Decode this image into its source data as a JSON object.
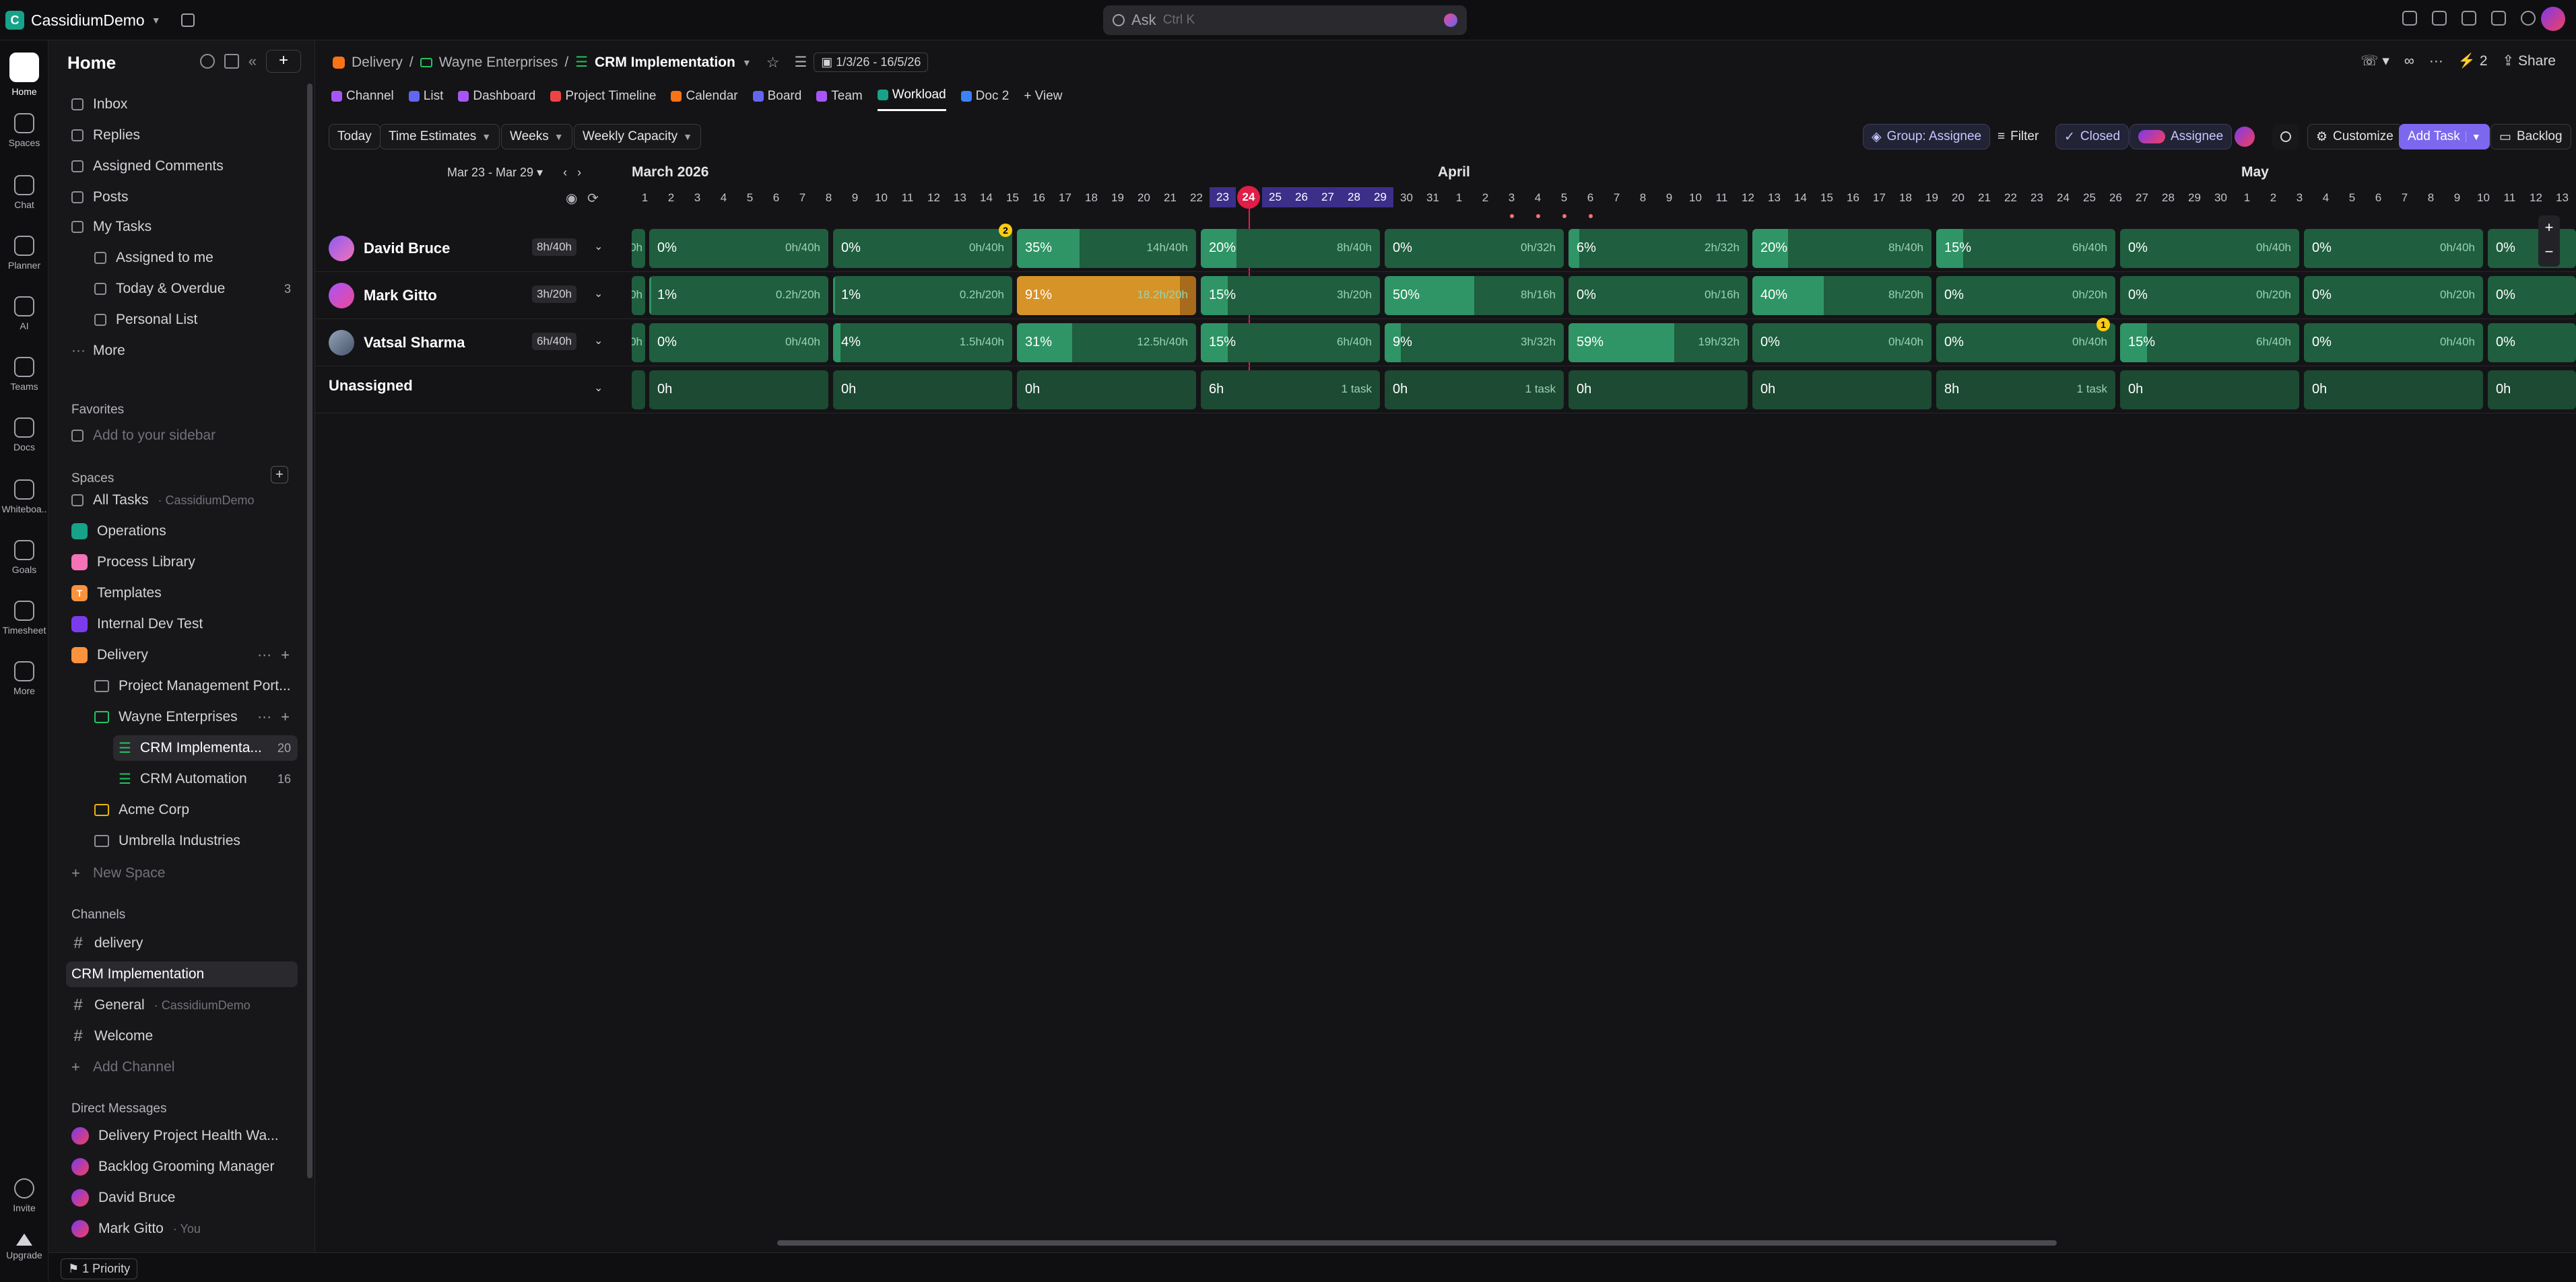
{
  "workspace": {
    "initial": "C",
    "name": "CassidiumDemo"
  },
  "search": {
    "placeholder": "Ask",
    "shortcut": "Ctrl K"
  },
  "rail": [
    {
      "label": "Home",
      "icon": "home-icon"
    },
    {
      "label": "Spaces",
      "icon": "spaces-icon"
    },
    {
      "label": "Chat",
      "icon": "chat-icon"
    },
    {
      "label": "Planner",
      "icon": "planner-icon"
    },
    {
      "label": "AI",
      "icon": "ai-icon"
    },
    {
      "label": "Teams",
      "icon": "teams-icon"
    },
    {
      "label": "Docs",
      "icon": "docs-icon"
    },
    {
      "label": "Whiteboa..",
      "icon": "whiteboard-icon"
    },
    {
      "label": "Goals",
      "icon": "goals-icon"
    },
    {
      "label": "Timesheet",
      "icon": "timesheet-icon"
    },
    {
      "label": "More",
      "icon": "more-icon"
    }
  ],
  "rail_bottom": {
    "invite": "Invite",
    "upgrade": "Upgrade"
  },
  "sidebar": {
    "title": "Home",
    "items": [
      "Inbox",
      "Replies",
      "Assigned Comments",
      "Posts",
      "My Tasks",
      "Assigned to me",
      "Today & Overdue",
      "Personal List",
      "More"
    ],
    "today_count": "3",
    "favorites_title": "Favorites",
    "favorites_add": "Add to your sidebar",
    "spaces_title": "Spaces",
    "all_tasks": "All Tasks",
    "all_tasks_sub": "· CassidiumDemo",
    "spaces": [
      "Operations",
      "Process Library",
      "Templates",
      "Internal Dev Test",
      "Delivery"
    ],
    "delivery_children": [
      "Project Management Port...",
      "Wayne Enterprises",
      "CRM Implementa...",
      "CRM Automation",
      "Acme Corp",
      "Umbrella Industries"
    ],
    "crm_impl_count": "20",
    "crm_auto_count": "16",
    "new_space": "New Space",
    "channels_title": "Channels",
    "channels": [
      "delivery",
      "CRM Implementation",
      "General",
      "Welcome"
    ],
    "general_sub": "· CassidiumDemo",
    "add_channel": "Add Channel",
    "dm_title": "Direct Messages",
    "dms": [
      "Delivery Project Health Wa...",
      "Backlog Grooming Manager",
      "David Bruce",
      "Mark Gitto"
    ],
    "dm_you": "· You"
  },
  "bottom": {
    "priority": "1 Priority"
  },
  "breadcrumb": [
    "Delivery",
    "Wayne Enterprises",
    "CRM Implementation"
  ],
  "date_chip": "1/3/26 - 16/5/26",
  "top_right": {
    "share": "Share",
    "count": "2"
  },
  "tabs": [
    "Channel",
    "List",
    "Dashboard",
    "Project Timeline",
    "Calendar",
    "Board",
    "Team",
    "Workload",
    "Doc 2",
    "+ View"
  ],
  "toolbar": {
    "today": "Today",
    "time_estimates": "Time Estimates",
    "weeks": "Weeks",
    "capacity": "Weekly Capacity",
    "group": "Group: Assignee",
    "filter": "Filter",
    "closed": "Closed",
    "assignee": "Assignee",
    "customize": "Customize",
    "add_task": "Add Task",
    "backlog": "Backlog"
  },
  "timeline": {
    "range": "Mar 23 - Mar 29",
    "months": [
      "March 2026",
      "April",
      "May"
    ],
    "days": [
      "1",
      "2",
      "3",
      "4",
      "5",
      "6",
      "7",
      "8",
      "9",
      "10",
      "11",
      "12",
      "13",
      "14",
      "15",
      "16",
      "17",
      "18",
      "19",
      "20",
      "21",
      "22",
      "23",
      "24",
      "25",
      "26",
      "27",
      "28",
      "29",
      "30",
      "31",
      "1",
      "2",
      "3",
      "4",
      "5",
      "6",
      "7",
      "8",
      "9",
      "10",
      "11",
      "12",
      "13",
      "14",
      "15",
      "16",
      "17",
      "18",
      "19",
      "20",
      "21",
      "22",
      "23",
      "24",
      "25",
      "26",
      "27",
      "28",
      "29",
      "30",
      "1",
      "2",
      "3",
      "4",
      "5",
      "6",
      "7",
      "8",
      "9",
      "10",
      "11",
      "12",
      "13"
    ],
    "today": "24",
    "badges": [
      "2",
      "1"
    ],
    "people": [
      {
        "name": "David Bruce",
        "cap": "8h/40h",
        "lead": "0h",
        "weeks": [
          {
            "pct": "0%",
            "hrs": "0h/40h",
            "fill": 0
          },
          {
            "pct": "0%",
            "hrs": "0h/40h",
            "fill": 0
          },
          {
            "pct": "35%",
            "hrs": "14h/40h",
            "fill": 0.35
          },
          {
            "pct": "20%",
            "hrs": "8h/40h",
            "fill": 0.2
          },
          {
            "pct": "0%",
            "hrs": "0h/32h",
            "fill": 0
          },
          {
            "pct": "6%",
            "hrs": "2h/32h",
            "fill": 0.06
          },
          {
            "pct": "20%",
            "hrs": "8h/40h",
            "fill": 0.2
          },
          {
            "pct": "15%",
            "hrs": "6h/40h",
            "fill": 0.15
          },
          {
            "pct": "0%",
            "hrs": "0h/40h",
            "fill": 0
          },
          {
            "pct": "0%",
            "hrs": "0h/40h",
            "fill": 0
          },
          {
            "pct": "0%",
            "hrs": "",
            "fill": 0
          }
        ]
      },
      {
        "name": "Mark Gitto",
        "cap": "3h/20h",
        "lead": "0h",
        "weeks": [
          {
            "pct": "1%",
            "hrs": "0.2h/20h",
            "fill": 0.01
          },
          {
            "pct": "1%",
            "hrs": "0.2h/20h",
            "fill": 0.01
          },
          {
            "pct": "91%",
            "hrs": "18.2h/20h",
            "fill": 0.91,
            "over": true
          },
          {
            "pct": "15%",
            "hrs": "3h/20h",
            "fill": 0.15
          },
          {
            "pct": "50%",
            "hrs": "8h/16h",
            "fill": 0.5
          },
          {
            "pct": "0%",
            "hrs": "0h/16h",
            "fill": 0
          },
          {
            "pct": "40%",
            "hrs": "8h/20h",
            "fill": 0.4
          },
          {
            "pct": "0%",
            "hrs": "0h/20h",
            "fill": 0
          },
          {
            "pct": "0%",
            "hrs": "0h/20h",
            "fill": 0
          },
          {
            "pct": "0%",
            "hrs": "0h/20h",
            "fill": 0
          },
          {
            "pct": "0%",
            "hrs": "",
            "fill": 0
          }
        ]
      },
      {
        "name": "Vatsal Sharma",
        "cap": "6h/40h",
        "lead": "0h",
        "weeks": [
          {
            "pct": "0%",
            "hrs": "0h/40h",
            "fill": 0
          },
          {
            "pct": "4%",
            "hrs": "1.5h/40h",
            "fill": 0.04
          },
          {
            "pct": "31%",
            "hrs": "12.5h/40h",
            "fill": 0.31
          },
          {
            "pct": "15%",
            "hrs": "6h/40h",
            "fill": 0.15
          },
          {
            "pct": "9%",
            "hrs": "3h/32h",
            "fill": 0.09
          },
          {
            "pct": "59%",
            "hrs": "19h/32h",
            "fill": 0.59
          },
          {
            "pct": "0%",
            "hrs": "0h/40h",
            "fill": 0
          },
          {
            "pct": "0%",
            "hrs": "0h/40h",
            "fill": 0
          },
          {
            "pct": "15%",
            "hrs": "6h/40h",
            "fill": 0.15
          },
          {
            "pct": "0%",
            "hrs": "0h/40h",
            "fill": 0
          },
          {
            "pct": "0%",
            "hrs": "",
            "fill": 0
          }
        ]
      },
      {
        "name": "Unassigned",
        "cap": "",
        "lead": "",
        "weeks": [
          {
            "pct": "0h",
            "hrs": "",
            "fill": 0
          },
          {
            "pct": "0h",
            "hrs": "",
            "fill": 0
          },
          {
            "pct": "0h",
            "hrs": "",
            "fill": 0
          },
          {
            "pct": "6h",
            "hrs": "1 task",
            "fill": 0
          },
          {
            "pct": "0h",
            "hrs": "1 task",
            "fill": 0
          },
          {
            "pct": "0h",
            "hrs": "",
            "fill": 0
          },
          {
            "pct": "0h",
            "hrs": "",
            "fill": 0
          },
          {
            "pct": "8h",
            "hrs": "1 task",
            "fill": 0
          },
          {
            "pct": "0h",
            "hrs": "",
            "fill": 0
          },
          {
            "pct": "0h",
            "hrs": "",
            "fill": 0
          },
          {
            "pct": "0h",
            "hrs": "",
            "fill": 0
          }
        ]
      }
    ]
  }
}
